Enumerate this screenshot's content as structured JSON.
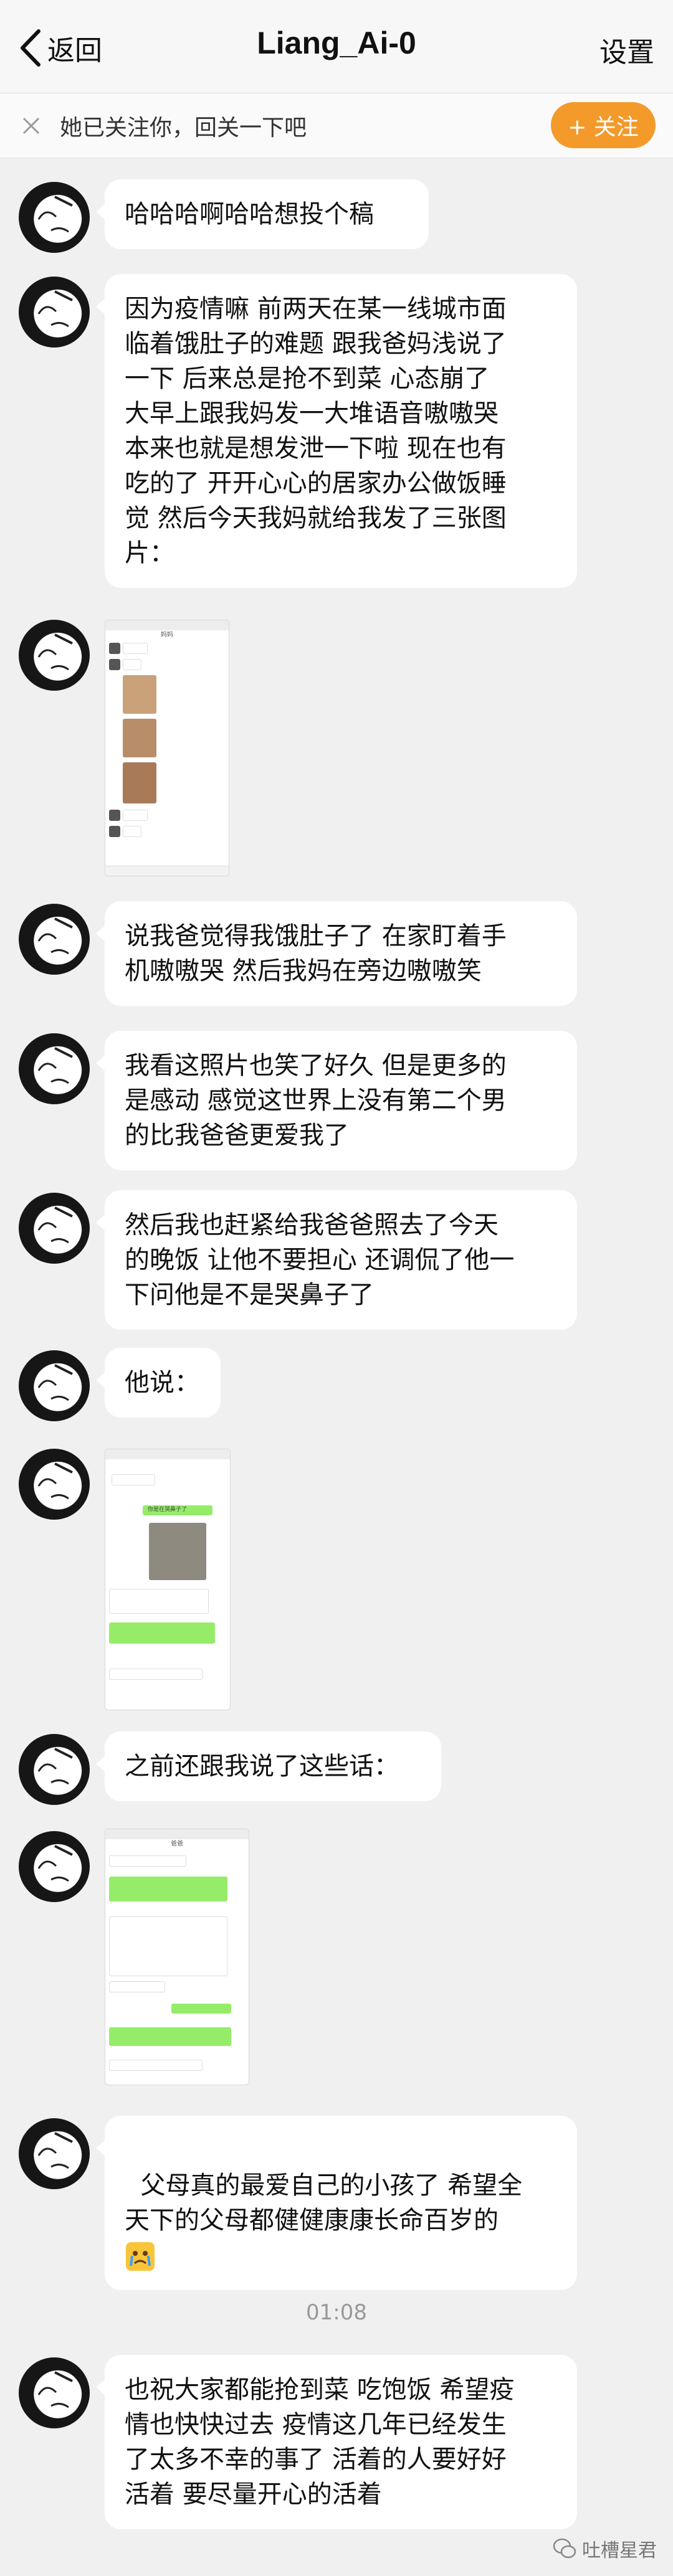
{
  "nav": {
    "back_label": "返回",
    "title": "Liang_Ai-0",
    "settings_label": "设置"
  },
  "follow_bar": {
    "message": "她已关注你，回关一下吧",
    "button_label": "+ 关注"
  },
  "messages": [
    {
      "type": "text",
      "text": "哈哈哈啊哈哈想投个稿"
    },
    {
      "type": "text",
      "text": "因为疫情嘛 前两天在某一线城市面\n临着饿肚子的难题 跟我爸妈浅说了\n一下 后来总是抢不到菜 心态崩了\n大早上跟我妈发一大堆语音嗷嗷哭\n本来也就是想发泄一下啦 现在也有\n吃的了 开开心心的居家办公做饭睡\n觉 然后今天我妈就给我发了三张图\n片："
    },
    {
      "type": "image",
      "caption": "妈妈"
    },
    {
      "type": "text",
      "text": "说我爸觉得我饿肚子了 在家盯着手\n机嗷嗷哭 然后我妈在旁边嗷嗷笑"
    },
    {
      "type": "text",
      "text": "我看这照片也笑了好久 但是更多的\n是感动 感觉这世界上没有第二个男\n的比我爸爸更爱我了"
    },
    {
      "type": "text",
      "text": "然后我也赶紧给我爸爸照去了今天\n的晚饭 让他不要担心 还调侃了他一\n下问他是不是哭鼻子了"
    },
    {
      "type": "text",
      "text": "他说："
    },
    {
      "type": "image",
      "caption": "你是在哭鼻子了"
    },
    {
      "type": "text",
      "text": "之前还跟我说了这些话："
    },
    {
      "type": "image",
      "caption": "爸爸"
    },
    {
      "type": "text",
      "text": "父母真的最爱自己的小孩了 希望全\n天下的父母都健健康康长命百岁的\n"
    },
    {
      "type": "timestamp",
      "text": "01:08"
    },
    {
      "type": "text",
      "text": "也祝大家都能抢到菜 吃饱饭 希望疫\n情也快快过去 疫情这几年已经发生\n了太多不幸的事了 活着的人要好好\n活着 要尽量开心的活着"
    }
  ],
  "watermark": {
    "text": "吐槽星君"
  },
  "colors": {
    "accent_orange": "#f39a2b",
    "bubble_bg": "#ffffff",
    "chat_bg": "#f0f0f0",
    "wechat_green": "#95ec69"
  },
  "icons": {
    "back": "chevron-left-icon",
    "close": "close-icon",
    "emoji": "crying-emoji-icon",
    "watermark": "wechat-logo-icon"
  }
}
